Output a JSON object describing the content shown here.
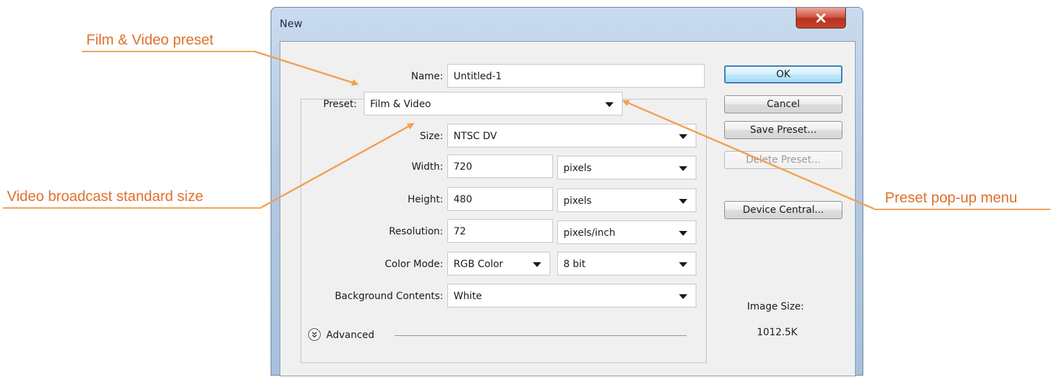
{
  "callouts": {
    "film_video_preset": "Film & Video preset",
    "video_broadcast_size": "Video broadcast standard size",
    "preset_popup_menu": "Preset pop-up menu"
  },
  "dialog": {
    "title": "New",
    "close_icon": "close-x-icon"
  },
  "form": {
    "name_label": "Name:",
    "name_value": "Untitled-1",
    "preset_label": "Preset:",
    "preset_value": "Film & Video",
    "size_label": "Size:",
    "size_value": "NTSC DV",
    "width_label": "Width:",
    "width_value": "720",
    "width_unit": "pixels",
    "height_label": "Height:",
    "height_value": "480",
    "height_unit": "pixels",
    "resolution_label": "Resolution:",
    "resolution_value": "72",
    "resolution_unit": "pixels/inch",
    "color_mode_label": "Color Mode:",
    "color_mode_value": "RGB Color",
    "bit_depth_value": "8 bit",
    "background_label": "Background Contents:",
    "background_value": "White",
    "advanced_label": "Advanced",
    "advanced_icon": "chevron-double-down-icon"
  },
  "buttons": {
    "ok": "OK",
    "cancel": "Cancel",
    "save_preset": "Save Preset...",
    "delete_preset": "Delete Preset...",
    "device_central": "Device Central..."
  },
  "info": {
    "image_size_label": "Image Size:",
    "image_size_value": "1012.5K"
  },
  "colors": {
    "callout": "#e0702a",
    "arrow": "#f2a152"
  }
}
